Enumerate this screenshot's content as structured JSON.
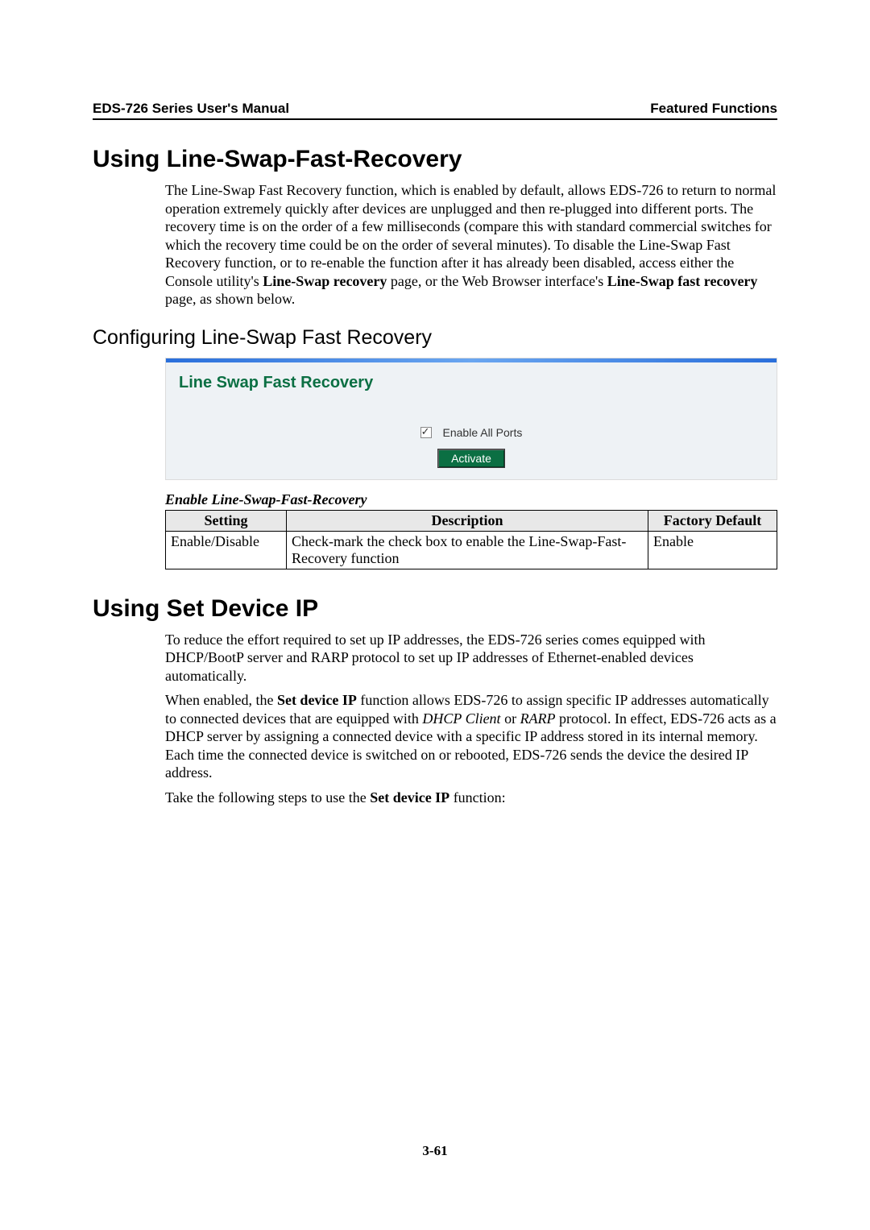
{
  "header": {
    "left": "EDS-726 Series User's Manual",
    "right": "Featured Functions"
  },
  "section1": {
    "title": "Using Line-Swap-Fast-Recovery",
    "para_pre": "The Line-Swap Fast Recovery function, which is enabled by default, allows EDS-726 to return to normal operation extremely quickly after devices are unplugged and then re-plugged into different ports. The recovery time is on the order of a few milliseconds (compare this with standard commercial switches for which the recovery time could be on the order of several minutes). To disable the Line-Swap Fast Recovery function, or to re-enable the function after it has already been disabled, access either the Console utility's ",
    "para_bold1": "Line-Swap recovery",
    "para_mid": " page, or the Web Browser interface's ",
    "para_bold2": "Line-Swap fast recovery",
    "para_end": " page, as shown below."
  },
  "subsection": {
    "title": "Configuring Line-Swap Fast Recovery"
  },
  "figure": {
    "title": "Line Swap Fast Recovery",
    "checkbox_label": "Enable All Ports",
    "button": "Activate"
  },
  "table": {
    "caption": "Enable Line-Swap-Fast-Recovery",
    "headers": {
      "setting": "Setting",
      "description": "Description",
      "default": "Factory Default"
    },
    "rows": [
      {
        "setting": "Enable/Disable",
        "description": "Check-mark the check box to enable the Line-Swap-Fast-Recovery function",
        "default": "Enable"
      }
    ]
  },
  "section2": {
    "title": "Using Set Device IP",
    "p1": "To reduce the effort required to set up IP addresses, the EDS-726 series comes equipped with DHCP/BootP server and RARP protocol to set up IP addresses of Ethernet-enabled devices automatically.",
    "p2_pre": "When enabled, the ",
    "p2_b1": "Set device IP",
    "p2_mid1": " function allows EDS-726 to assign specific IP addresses automatically to connected devices that are equipped with ",
    "p2_i1": "DHCP Client",
    "p2_mid2": " or ",
    "p2_i2": "RARP",
    "p2_end": " protocol. In effect, EDS-726 acts as a DHCP server by assigning a connected device with a specific IP address stored in its internal memory. Each time the connected device is switched on or rebooted, EDS-726 sends the device the desired IP address.",
    "p3_pre": "Take the following steps to use the ",
    "p3_b1": "Set device IP",
    "p3_end": " function:"
  },
  "footer": {
    "page_number": "3-61"
  }
}
